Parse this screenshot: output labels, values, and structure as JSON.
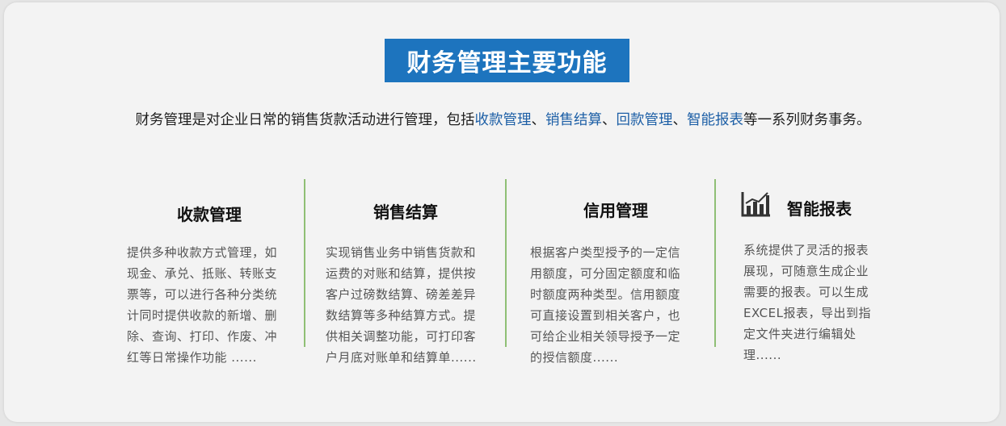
{
  "title": "财务管理主要功能",
  "intro": {
    "prefix": "财务管理是对企业日常的销售货款活动进行管理，包括",
    "links": [
      "收款管理",
      "销售结算",
      "回款管理",
      "智能报表"
    ],
    "separator": "、",
    "suffix": "等一系列财务事务。"
  },
  "cards": [
    {
      "title": "收款管理",
      "lines": [
        "提供多种收款方式管理，如",
        "现金、承兑、抵账、转账支",
        "票等，可以进行各种分类统",
        "计同时提供收款的新增、删",
        "除、查询、打印、作废、冲",
        "红等日常操作功能 ......"
      ]
    },
    {
      "title": "销售结算",
      "lines": [
        "实现销售业务中销售货款和",
        "运费的对账和结算，提供按",
        "客户过磅数结算、磅差差异",
        "数结算等多种结算方式。提",
        "供相关调整功能，可打印客",
        "户月底对账单和结算单......"
      ]
    },
    {
      "title": "信用管理",
      "lines": [
        "根据客户类型授予的一定信",
        "用额度，可分固定额度和临",
        "时额度两种类型。信用额度",
        "可直接设置到相关客户，也",
        "可给企业相关领导授予一定",
        "的授信额度......"
      ]
    },
    {
      "title": "智能报表",
      "icon": "bar-chart-report-icon",
      "lines": [
        "系统提供了灵活的报表",
        "展现，可随意生成企业",
        "需要的报表。可以生成",
        "EXCEL报表，导出到指",
        "定文件夹进行编辑处",
        "理......"
      ]
    }
  ],
  "colors": {
    "accent": "#1d74be",
    "link": "#1d5fa6",
    "divider": "#8fbf75"
  }
}
